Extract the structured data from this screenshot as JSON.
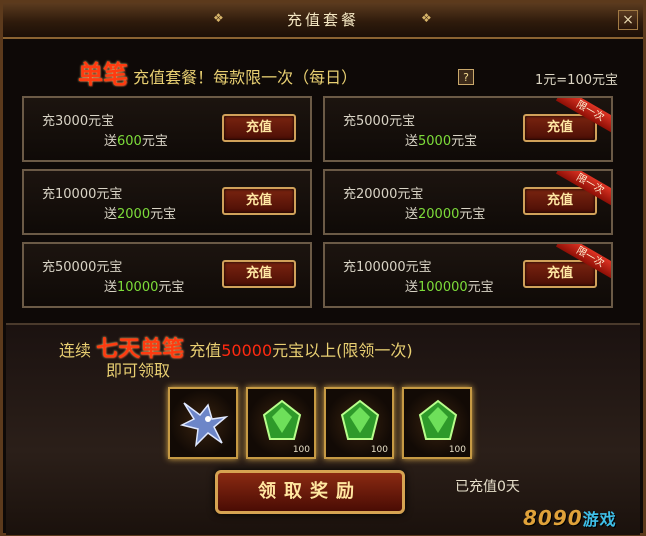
{
  "window": {
    "title": "充值套餐",
    "close_label": "×"
  },
  "header": {
    "highlight": "单笔",
    "text": "充值套餐！每款限一次（每日）",
    "help_label": "?",
    "rate": "1元=100元宝"
  },
  "packages": [
    {
      "charge": "充3000元宝",
      "bonus_prefix": "送",
      "bonus_num": "600",
      "bonus_suffix": "元宝",
      "button": "充值",
      "ribbon": ""
    },
    {
      "charge": "充5000元宝",
      "bonus_prefix": "送",
      "bonus_num": "5000",
      "bonus_suffix": "元宝",
      "button": "充值",
      "ribbon": "限一次"
    },
    {
      "charge": "充10000元宝",
      "bonus_prefix": "送",
      "bonus_num": "2000",
      "bonus_suffix": "元宝",
      "button": "充值",
      "ribbon": ""
    },
    {
      "charge": "充20000元宝",
      "bonus_prefix": "送",
      "bonus_num": "20000",
      "bonus_suffix": "元宝",
      "button": "充值",
      "ribbon": "限一次"
    },
    {
      "charge": "充50000元宝",
      "bonus_prefix": "送",
      "bonus_num": "10000",
      "bonus_suffix": "元宝",
      "button": "充值",
      "ribbon": ""
    },
    {
      "charge": "充100000元宝",
      "bonus_prefix": "送",
      "bonus_num": "100000",
      "bonus_suffix": "元宝",
      "button": "充值",
      "ribbon": "限一次"
    }
  ],
  "streak": {
    "prefix": "连续",
    "highlight": "七天单笔",
    "mid": "充值",
    "amount": "50000",
    "suffix": "元宝以上(限领一次)",
    "note": "即可领取"
  },
  "rewards": [
    {
      "icon": "dragon-mount-icon",
      "qty": ""
    },
    {
      "icon": "green-gem-icon",
      "qty": "100"
    },
    {
      "icon": "green-gem-icon",
      "qty": "100"
    },
    {
      "icon": "green-gem-icon",
      "qty": "100"
    }
  ],
  "claim_button": "领取奖励",
  "charged_status": "已充值0天",
  "brand": {
    "latin": "8090",
    "zh": "游戏"
  }
}
